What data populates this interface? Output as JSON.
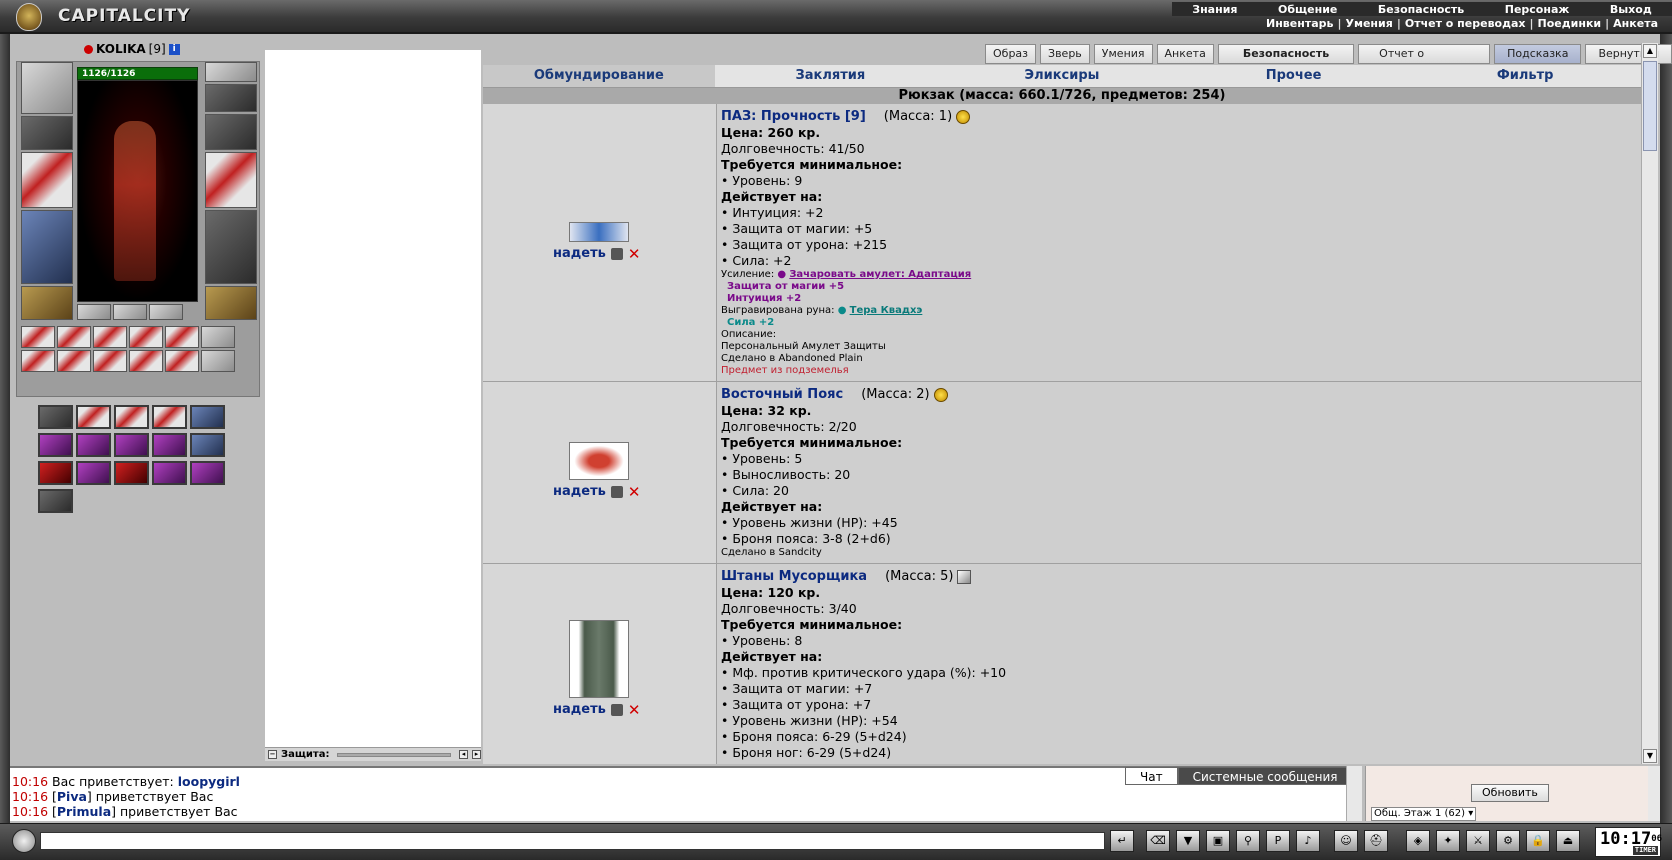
{
  "header": {
    "logo_text": "CAPITALCITY",
    "menu_top": [
      "Знания",
      "Общение",
      "Безопасность",
      "Персонаж",
      "Выход"
    ],
    "menu_sub": [
      "Инвентарь",
      "Умения",
      "Отчет о переводах",
      "Поединки",
      "Анкета"
    ]
  },
  "character": {
    "name": "KOLIKA",
    "level": "[9]",
    "hp": "1126/1126"
  },
  "defense_label": "Защита:",
  "nav_buttons": [
    "Образ",
    "Зверь",
    "Умения",
    "Анкета",
    "Безопасность",
    "Отчет о переводах",
    "Подсказка",
    "Вернуться"
  ],
  "inventory": {
    "tabs": [
      "Обмундирование",
      "Заклятия",
      "Эликсиры",
      "Прочее",
      "Фильтр"
    ],
    "backpack_summary": "Рюкзак (масса: 660.1/726, предметов: 254)",
    "wear_label": "надеть",
    "items": [
      {
        "name": "ПАЗ: Прочность [9]",
        "mass": "(Масса: 1)",
        "price": "Цена: 260 кр.",
        "durability": "Долговечность: 41/50",
        "req_title": "Требуется минимальное:",
        "reqs": [
          "• Уровень: 9"
        ],
        "acts_title": "Действует на:",
        "acts": [
          "• Интуиция: +2",
          "• Защита от магии: +5",
          "• Защита от урона: +215",
          "• Сила: +2"
        ],
        "enh_label": "Усиление:",
        "enh_link": "Зачаровать амулет: Адаптация",
        "enh_bonus1": "Защита от магии +5",
        "enh_bonus2": "Интуиция +2",
        "rune_label": "Выгравирована руна:",
        "rune_link": "Тера Квадхэ",
        "rune_bonus": "Сила +2",
        "desc_label": "Описание:",
        "desc": "Персональный Амулет Защиты",
        "made_in": "Сделано в Abandoned Plain",
        "dungeon_note": "Предмет из подземелья"
      },
      {
        "name": "Восточный Пояс",
        "mass": "(Масса: 2)",
        "price": "Цена: 32 кр.",
        "durability": "Долговечность: 2/20",
        "req_title": "Требуется минимальное:",
        "reqs": [
          "• Уровень: 5",
          "• Выносливость: 20",
          "• Сила: 20"
        ],
        "acts_title": "Действует на:",
        "acts": [
          "• Уровень жизни (HP): +45",
          "• Броня пояса: 3-8 (2+d6)"
        ],
        "made_in": "Сделано в Sandcity"
      },
      {
        "name": "Штаны Мусорщика",
        "mass": "(Масса: 5)",
        "price": "Цена: 120 кр.",
        "durability": "Долговечность: 3/40",
        "req_title": "Требуется минимальное:",
        "reqs": [
          "• Уровень: 8"
        ],
        "acts_title": "Действует на:",
        "acts": [
          "• Мф. против критического удара (%): +10",
          "• Защита от магии: +7",
          "• Защита от урона: +7",
          "• Уровень жизни (HP): +54",
          "• Броня пояса: 6-29 (5+d24)",
          "• Броня ног: 6-29 (5+d24)"
        ]
      }
    ]
  },
  "chat": {
    "tabs": [
      "Чат",
      "Системные сообщения"
    ],
    "lines": [
      {
        "time": "10:16",
        "pre": " Вас приветствует: ",
        "nick": "loopygirl",
        "post": ""
      },
      {
        "time": "10:16",
        "pre": " [",
        "nick": "Piva",
        "post": "] приветствует Вас"
      },
      {
        "time": "10:16",
        "pre": " [",
        "nick": "Primula",
        "post": "] приветствует Вас"
      }
    ],
    "refresh_label": "Обновить",
    "room": "Общ. Этаж 1 (62)"
  },
  "clock": {
    "time": "10:17",
    "seconds": "06",
    "timer_label": "TIMER"
  },
  "colors": {
    "link_blue": "#0c2a80",
    "enhance_purple": "#7a0a8a",
    "rune_teal": "#0a8a8a",
    "delete_red": "#d00000"
  }
}
